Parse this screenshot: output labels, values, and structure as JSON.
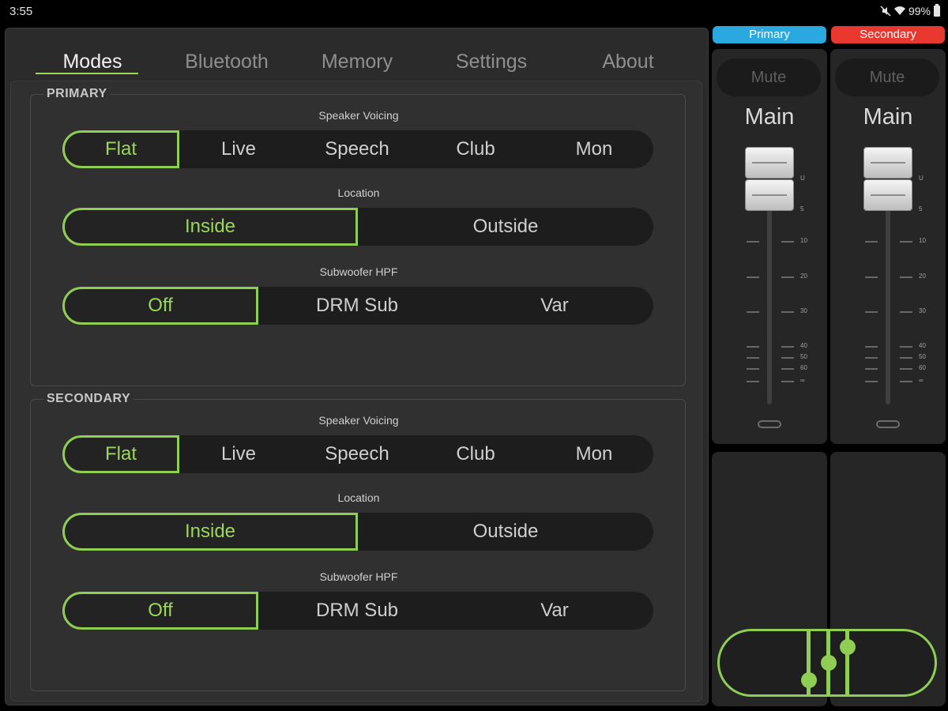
{
  "status": {
    "time": "3:55",
    "battery": "99%"
  },
  "tabs": [
    "Modes",
    "Bluetooth",
    "Memory",
    "Settings",
    "About"
  ],
  "sections": [
    {
      "title": "PRIMARY",
      "voicing_label": "Speaker Voicing",
      "voicing": [
        "Flat",
        "Live",
        "Speech",
        "Club",
        "Mon"
      ],
      "location_label": "Location",
      "location": [
        "Inside",
        "Outside"
      ],
      "hpf_label": "Subwoofer HPF",
      "hpf": [
        "Off",
        "DRM Sub",
        "Var"
      ]
    },
    {
      "title": "SECONDARY",
      "voicing_label": "Speaker Voicing",
      "voicing": [
        "Flat",
        "Live",
        "Speech",
        "Club",
        "Mon"
      ],
      "location_label": "Location",
      "location": [
        "Inside",
        "Outside"
      ],
      "hpf_label": "Subwoofer HPF",
      "hpf": [
        "Off",
        "DRM Sub",
        "Var"
      ]
    }
  ],
  "channels": [
    {
      "tag": "Primary",
      "tag_color": "#2aa8e0",
      "mute": "Mute",
      "label": "Main"
    },
    {
      "tag": "Secondary",
      "tag_color": "#e8382f",
      "mute": "Mute",
      "label": "Main"
    }
  ],
  "scale": [
    "U",
    "5",
    "10",
    "20",
    "30",
    "40",
    "50",
    "60",
    "∞"
  ]
}
